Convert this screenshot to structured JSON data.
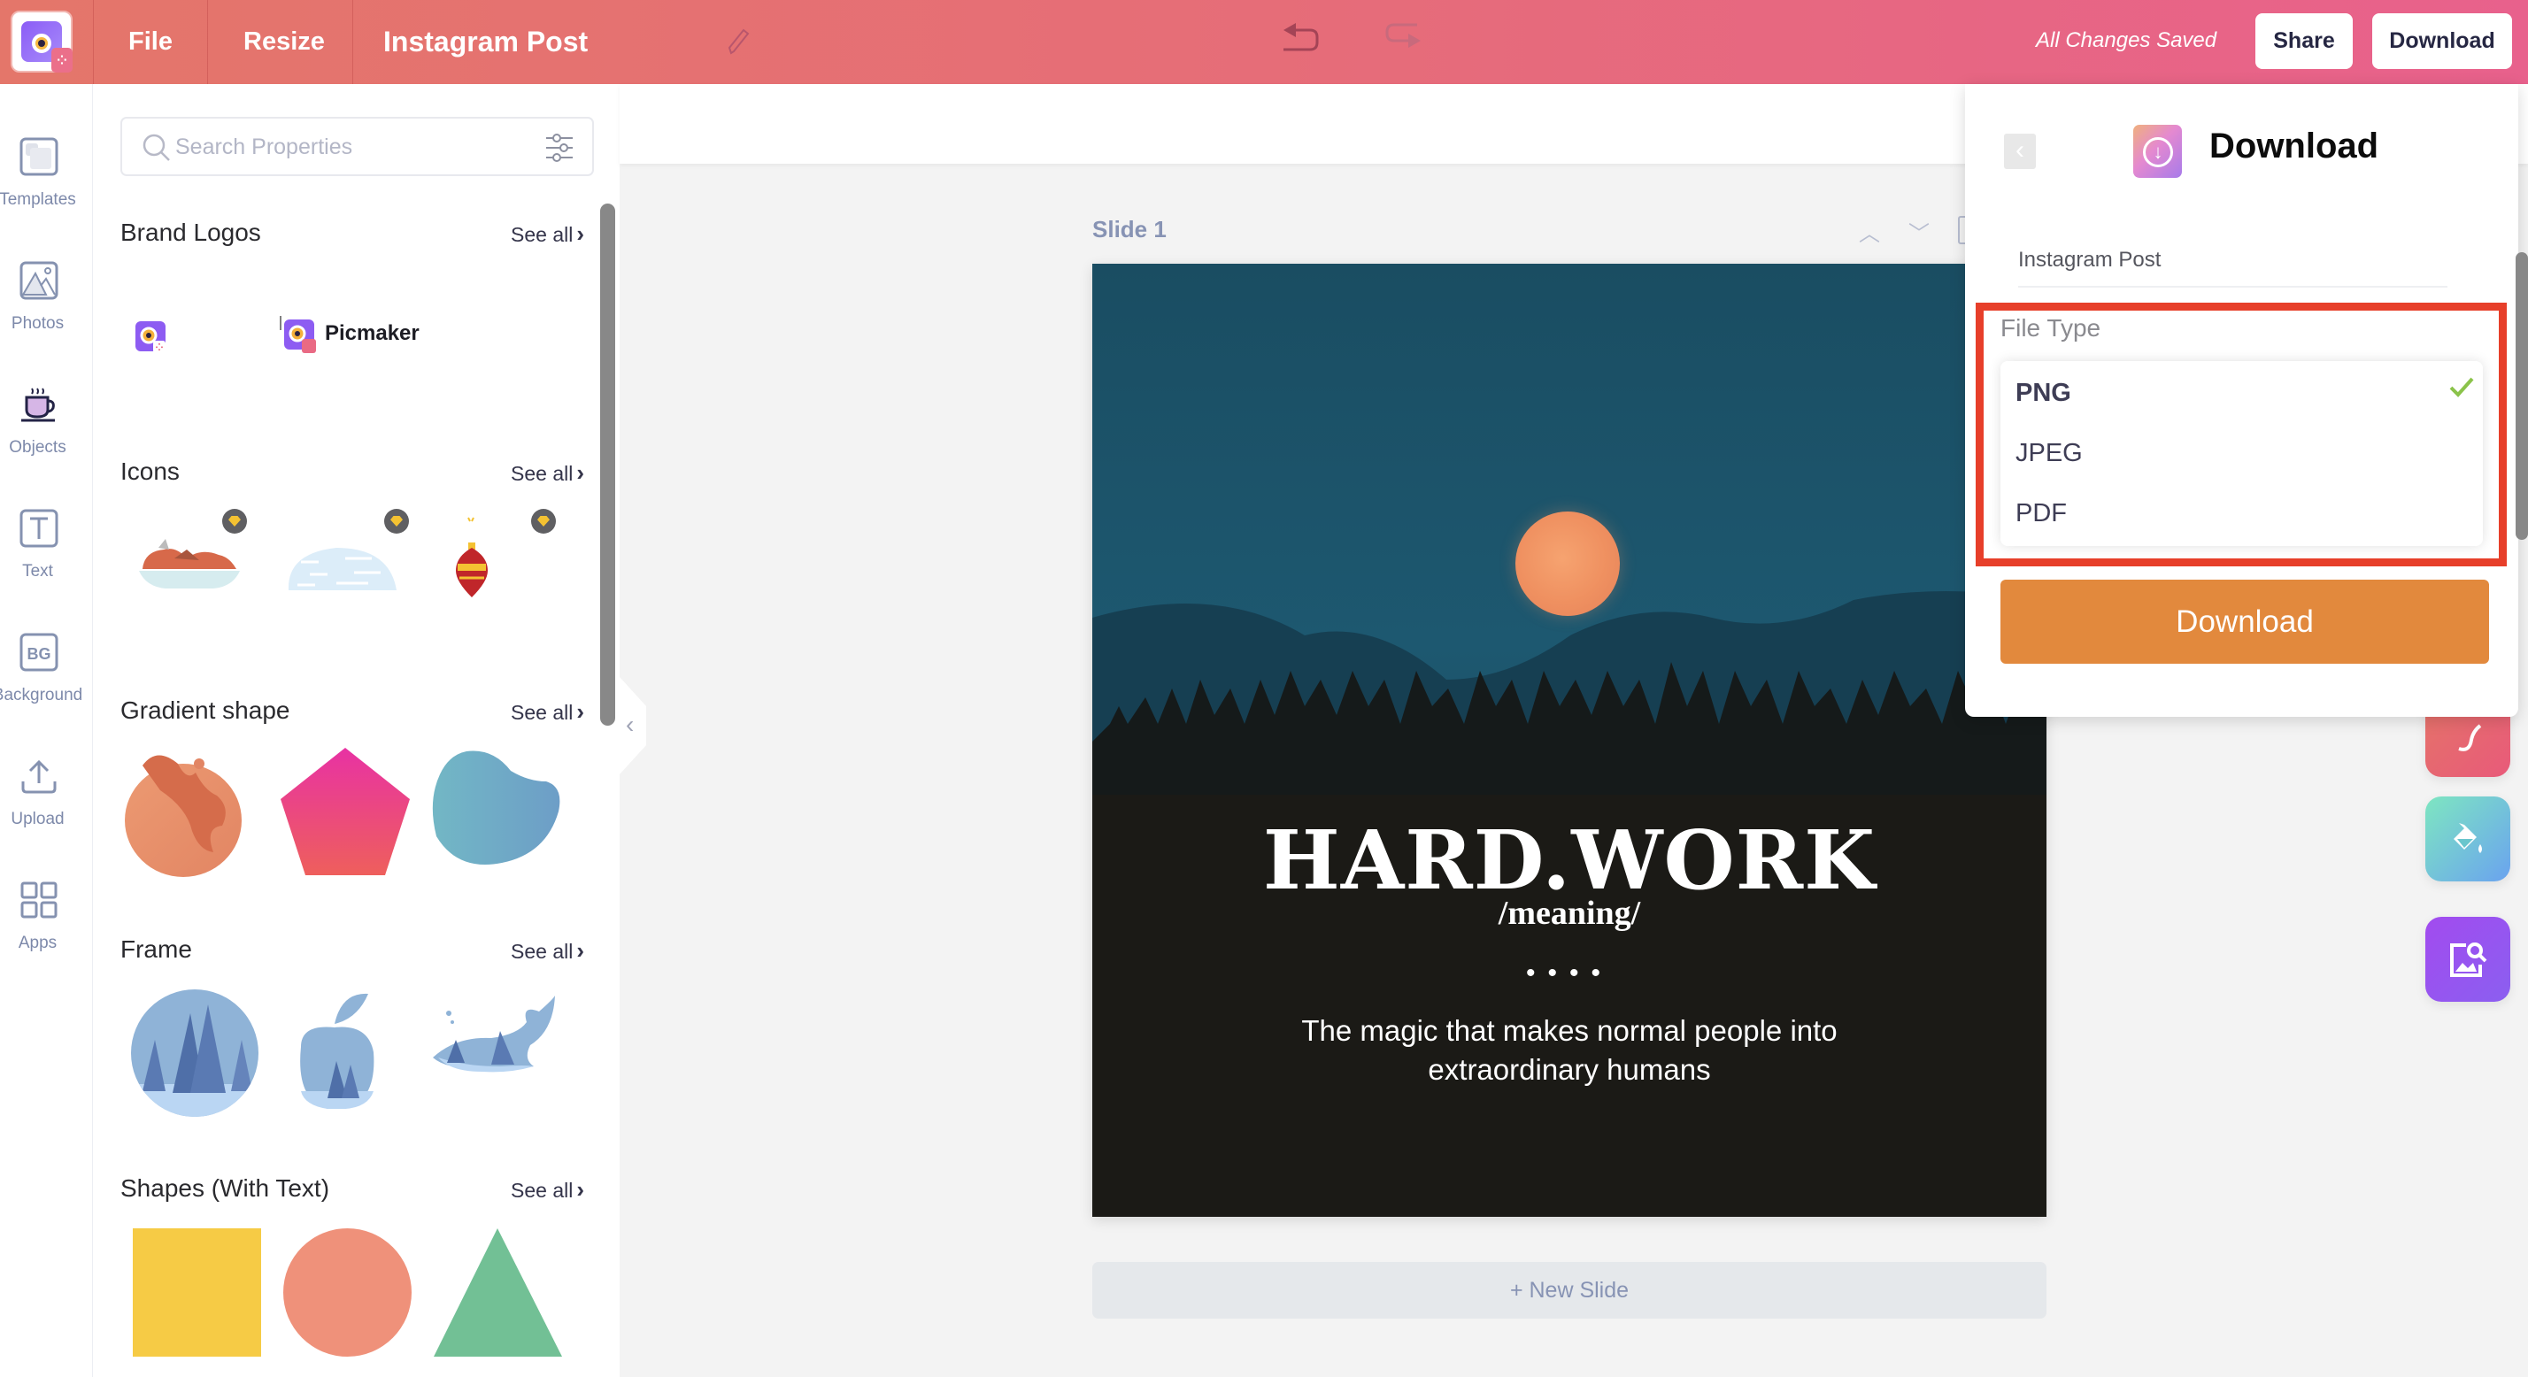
{
  "header": {
    "menu": {
      "file": "File",
      "resize": "Resize"
    },
    "document_title": "Instagram Post",
    "save_status": "All Changes Saved",
    "share_label": "Share",
    "download_label": "Download",
    "colors": {
      "gradient_start": "#e4766a",
      "gradient_end": "#e8618c"
    }
  },
  "rail": {
    "items": [
      {
        "label": "Templates",
        "icon": "templates-icon"
      },
      {
        "label": "Photos",
        "icon": "photos-icon"
      },
      {
        "label": "Objects",
        "icon": "objects-icon"
      },
      {
        "label": "Text",
        "icon": "text-icon"
      },
      {
        "label": "Background",
        "icon": "background-icon"
      },
      {
        "label": "Upload",
        "icon": "upload-icon"
      },
      {
        "label": "Apps",
        "icon": "apps-icon"
      }
    ],
    "active": "Objects"
  },
  "panel": {
    "search_placeholder": "Search Properties",
    "search_value": "",
    "see_all_label": "See all",
    "sections": [
      {
        "title": "Brand Logos",
        "items": [
          "Picmaker icon logo",
          "Picmaker wordmark logo"
        ],
        "wordmark_text": "Picmaker"
      },
      {
        "title": "Icons",
        "items": [
          "Grilled sausages",
          "Cloud",
          "Ornament"
        ],
        "premium": true
      },
      {
        "title": "Gradient shape",
        "items": [
          "Orange blob",
          "Pink pentagon",
          "Blue blob"
        ]
      },
      {
        "title": "Frame",
        "items": [
          "Circle frame",
          "Apple frame",
          "Whale frame"
        ]
      },
      {
        "title": "Shapes (With Text)",
        "items": [
          "Square",
          "Circle",
          "Triangle"
        ]
      }
    ]
  },
  "canvas": {
    "slide_label": "Slide 1",
    "slide": {
      "title": "HARD.WORK",
      "subtitle": "/meaning/",
      "dots": "••••",
      "body": "The magic that makes normal people into extraordinary humans"
    },
    "new_slide_label": "+ New Slide"
  },
  "download_panel": {
    "title": "Download",
    "document_name": "Instagram Post",
    "file_type_label": "File Type",
    "file_types": [
      "PNG",
      "JPEG",
      "PDF"
    ],
    "selected_file_type": "PNG",
    "download_button": "Download",
    "colors": {
      "button": "#e2893d",
      "highlight_border": "#e73f2a",
      "check": "#8bc34a"
    }
  },
  "floating_tools": [
    "animation-tool",
    "color-fill-tool",
    "image-search-tool"
  ]
}
